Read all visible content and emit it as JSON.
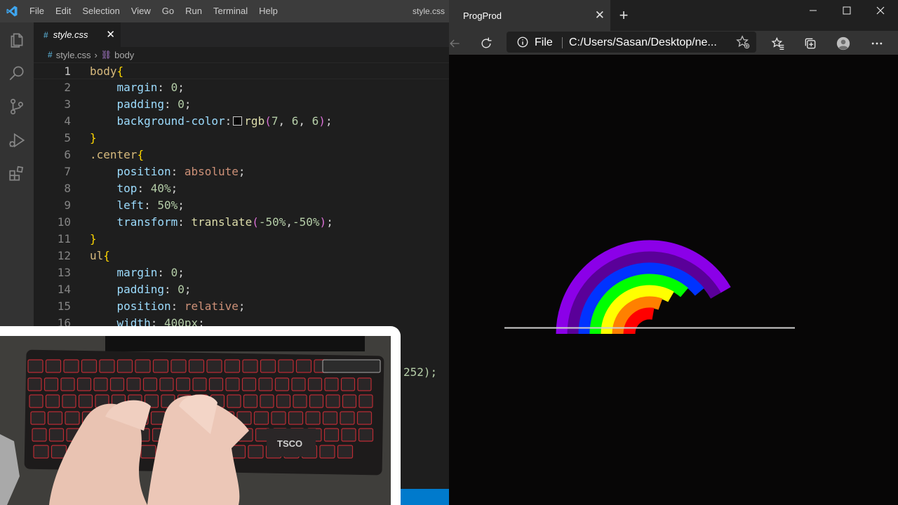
{
  "vscode": {
    "menu": [
      "File",
      "Edit",
      "Selection",
      "View",
      "Go",
      "Run",
      "Terminal",
      "Help"
    ],
    "window_title": "style.css",
    "tab": {
      "label": "style.css",
      "icon": "css-hash-icon",
      "close": "✕"
    },
    "breadcrumb": {
      "file": "style.css",
      "symbol": "body"
    },
    "activity_icons": [
      "files-icon",
      "search-icon",
      "source-control-icon",
      "run-debug-icon",
      "extensions-icon"
    ],
    "current_line": 1,
    "lines": [
      {
        "n": "1",
        "code": [
          [
            "sel",
            "body"
          ],
          [
            "brace",
            "{"
          ]
        ]
      },
      {
        "n": "2",
        "code": [
          [
            "sp",
            "    "
          ],
          [
            "prop",
            "margin"
          ],
          [
            "punc",
            ": "
          ],
          [
            "num",
            "0"
          ],
          [
            "punc",
            ";"
          ]
        ]
      },
      {
        "n": "3",
        "code": [
          [
            "sp",
            "    "
          ],
          [
            "prop",
            "padding"
          ],
          [
            "punc",
            ": "
          ],
          [
            "num",
            "0"
          ],
          [
            "punc",
            ";"
          ]
        ]
      },
      {
        "n": "4",
        "code": [
          [
            "sp",
            "    "
          ],
          [
            "prop",
            "background-color"
          ],
          [
            "punc",
            ":"
          ],
          [
            "swatch",
            ""
          ],
          [
            "fn",
            "rgb"
          ],
          [
            "paren",
            "("
          ],
          [
            "num",
            "7"
          ],
          [
            "punc",
            ", "
          ],
          [
            "num",
            "6"
          ],
          [
            "punc",
            ", "
          ],
          [
            "num",
            "6"
          ],
          [
            "paren",
            ")"
          ],
          [
            "punc",
            ";"
          ]
        ]
      },
      {
        "n": "5",
        "code": [
          [
            "brace",
            "}"
          ]
        ]
      },
      {
        "n": "6",
        "code": [
          [
            "sel",
            ".center"
          ],
          [
            "brace",
            "{"
          ]
        ]
      },
      {
        "n": "7",
        "code": [
          [
            "sp",
            "    "
          ],
          [
            "prop",
            "position"
          ],
          [
            "punc",
            ": "
          ],
          [
            "val",
            "absolute"
          ],
          [
            "punc",
            ";"
          ]
        ]
      },
      {
        "n": "8",
        "code": [
          [
            "sp",
            "    "
          ],
          [
            "prop",
            "top"
          ],
          [
            "punc",
            ": "
          ],
          [
            "num",
            "40%"
          ],
          [
            "punc",
            ";"
          ]
        ]
      },
      {
        "n": "9",
        "code": [
          [
            "sp",
            "    "
          ],
          [
            "prop",
            "left"
          ],
          [
            "punc",
            ": "
          ],
          [
            "num",
            "50%"
          ],
          [
            "punc",
            ";"
          ]
        ]
      },
      {
        "n": "10",
        "code": [
          [
            "sp",
            "    "
          ],
          [
            "prop",
            "transform"
          ],
          [
            "punc",
            ": "
          ],
          [
            "fn",
            "translate"
          ],
          [
            "paren",
            "("
          ],
          [
            "num",
            "-50%"
          ],
          [
            "punc",
            ","
          ],
          [
            "num",
            "-50%"
          ],
          [
            "paren",
            ")"
          ],
          [
            "punc",
            ";"
          ]
        ]
      },
      {
        "n": "11",
        "code": [
          [
            "brace",
            "}"
          ]
        ]
      },
      {
        "n": "12",
        "code": [
          [
            "sel",
            "ul"
          ],
          [
            "brace",
            "{"
          ]
        ]
      },
      {
        "n": "13",
        "code": [
          [
            "sp",
            "    "
          ],
          [
            "prop",
            "margin"
          ],
          [
            "punc",
            ": "
          ],
          [
            "num",
            "0"
          ],
          [
            "punc",
            ";"
          ]
        ]
      },
      {
        "n": "14",
        "code": [
          [
            "sp",
            "    "
          ],
          [
            "prop",
            "padding"
          ],
          [
            "punc",
            ": "
          ],
          [
            "num",
            "0"
          ],
          [
            "punc",
            ";"
          ]
        ]
      },
      {
        "n": "15",
        "code": [
          [
            "sp",
            "    "
          ],
          [
            "prop",
            "position"
          ],
          [
            "punc",
            ": "
          ],
          [
            "val",
            "relative"
          ],
          [
            "punc",
            ";"
          ]
        ]
      },
      {
        "n": "16",
        "code": [
          [
            "sp",
            "    "
          ],
          [
            "prop",
            "width"
          ],
          [
            "punc",
            ": "
          ],
          [
            "num",
            "400px"
          ],
          [
            "punc",
            ";"
          ]
        ]
      }
    ],
    "partial_line_text": "252);"
  },
  "webcam": {
    "keyboard_brand": "TSCO",
    "keyboard_backlight_color": "#e0303a"
  },
  "browser": {
    "tab_title": "ProgProd",
    "new_tab_label": "+",
    "address": {
      "scheme_label": "File",
      "url": "C:/Users/Sasan/Desktop/ne..."
    },
    "page": {
      "background": "#070606",
      "rainbow_colors": [
        "#8b00e8",
        "#5a0099",
        "#0033ff",
        "#00ff00",
        "#ffff00",
        "#ff8000",
        "#ff0000"
      ]
    }
  }
}
